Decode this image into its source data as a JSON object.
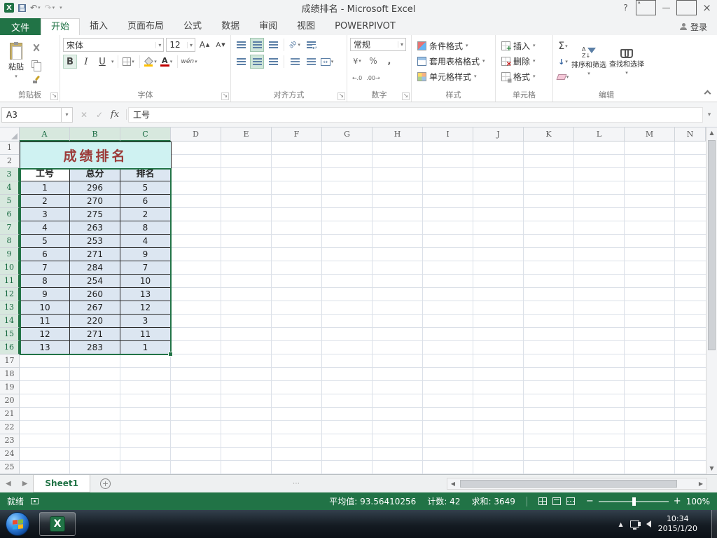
{
  "window": {
    "title": "成绩排名 - Microsoft Excel"
  },
  "ribbon_tabs": {
    "file_label": "文件",
    "active": "开始",
    "tabs": [
      "开始",
      "插入",
      "页面布局",
      "公式",
      "数据",
      "审阅",
      "视图",
      "POWERPIVOT"
    ],
    "sign_in_label": "登录"
  },
  "ribbon": {
    "clipboard": {
      "label": "剪贴板",
      "paste_label": "粘贴"
    },
    "font": {
      "label": "字体",
      "font_name": "宋体",
      "font_size": "12",
      "phonetic_label": "wén"
    },
    "alignment": {
      "label": "对齐方式"
    },
    "number": {
      "label": "数字",
      "format": "常规"
    },
    "styles": {
      "label": "样式",
      "items": [
        "条件格式",
        "套用表格格式",
        "单元格样式"
      ]
    },
    "cells": {
      "label": "单元格",
      "items": [
        "插入",
        "删除",
        "格式"
      ]
    },
    "editing": {
      "label": "编辑",
      "buttons": [
        "排序和筛选",
        "查找和选择"
      ]
    }
  },
  "formula_bar": {
    "name_box": "A3",
    "content": "工号"
  },
  "sheet": {
    "columns": [
      "A",
      "B",
      "C",
      "D",
      "E",
      "F",
      "G",
      "H",
      "I",
      "J",
      "K",
      "L",
      "M",
      "N"
    ],
    "visible_row_count": 25,
    "title_cell": {
      "range": "A1:C2",
      "text": "成绩排名",
      "fill": "#cff2f2",
      "text_color": "#9c3a38"
    },
    "table": {
      "headers": [
        "工号",
        "总分",
        "排名"
      ],
      "rows": [
        [
          1,
          296,
          5
        ],
        [
          2,
          270,
          6
        ],
        [
          3,
          275,
          2
        ],
        [
          4,
          263,
          8
        ],
        [
          5,
          253,
          4
        ],
        [
          6,
          271,
          9
        ],
        [
          7,
          284,
          7
        ],
        [
          8,
          254,
          10
        ],
        [
          9,
          260,
          13
        ],
        [
          10,
          267,
          12
        ],
        [
          11,
          220,
          3
        ],
        [
          12,
          271,
          11
        ],
        [
          13,
          283,
          1
        ]
      ]
    },
    "selection": {
      "range": "A3:C16",
      "active_cell": "A3",
      "columns": [
        "A",
        "B",
        "C"
      ],
      "row_start": 3,
      "row_end": 16
    }
  },
  "sheet_tabs": {
    "active": "Sheet1",
    "tabs": [
      "Sheet1"
    ]
  },
  "status_bar": {
    "mode": "就绪",
    "stats": [
      "平均值: 93.56410256",
      "计数: 42",
      "求和: 3649"
    ],
    "zoom_level": "100%"
  },
  "taskbar": {
    "time": "10:34",
    "date": "2015/1/20"
  },
  "theme": {
    "accent_green": "#217346",
    "selection_fill": "#dce6f1"
  }
}
